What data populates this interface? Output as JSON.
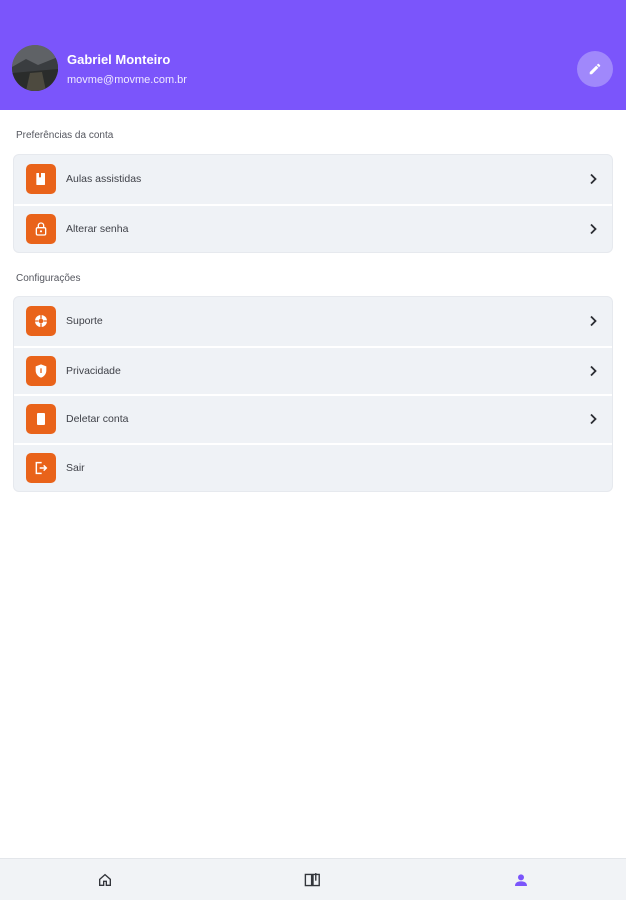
{
  "profile": {
    "name": "Gabriel Monteiro",
    "email": "movme@movme.com.br"
  },
  "sections": {
    "account": {
      "title": "Preferências da conta",
      "items": [
        {
          "label": "Aulas assistidas",
          "icon": "book-icon"
        },
        {
          "label": "Alterar senha",
          "icon": "lock-icon"
        }
      ]
    },
    "settings": {
      "title": "Configurações",
      "items": [
        {
          "label": "Suporte",
          "icon": "support-icon"
        },
        {
          "label": "Privacidade",
          "icon": "shield-icon"
        },
        {
          "label": "Deletar conta",
          "icon": "trash-icon"
        },
        {
          "label": "Sair",
          "icon": "logout-icon"
        }
      ]
    }
  },
  "bottom_nav": {
    "items": [
      {
        "icon": "home-icon",
        "active": false
      },
      {
        "icon": "courses-book-icon",
        "active": false
      },
      {
        "icon": "profile-icon",
        "active": true
      }
    ]
  },
  "colors": {
    "header": "#7b55fb",
    "accent_icon": "#e9631a",
    "active_nav": "#7b55fb"
  }
}
